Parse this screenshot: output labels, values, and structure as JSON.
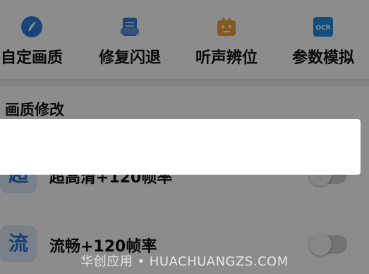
{
  "toolbar": {
    "items": [
      {
        "label": "自定画质",
        "icon": "brush-icon",
        "color": "#2b7de0"
      },
      {
        "label": "修复闪退",
        "icon": "repair-icon",
        "color": "#3a7fd8"
      },
      {
        "label": "听声辨位",
        "icon": "sound-icon",
        "color": "#f0a437"
      },
      {
        "label": "参数模拟",
        "icon": "ocr-icon",
        "icon_text": "OCR",
        "color": "#1f8fe6"
      }
    ]
  },
  "section": {
    "title": "画质修改"
  },
  "settings": [
    {
      "icon_char": "超",
      "label": "超高清+120帧率",
      "enabled": false
    },
    {
      "icon_char": "流",
      "label": "流畅+120帧率",
      "enabled": false
    }
  ],
  "watermark": "华创应用 • HUACHUANGZS.COM",
  "colors": {
    "accent": "#2b6fd1",
    "icon_bg": "#dfeaf8",
    "overlay": "rgba(0,0,0,0.45)"
  }
}
